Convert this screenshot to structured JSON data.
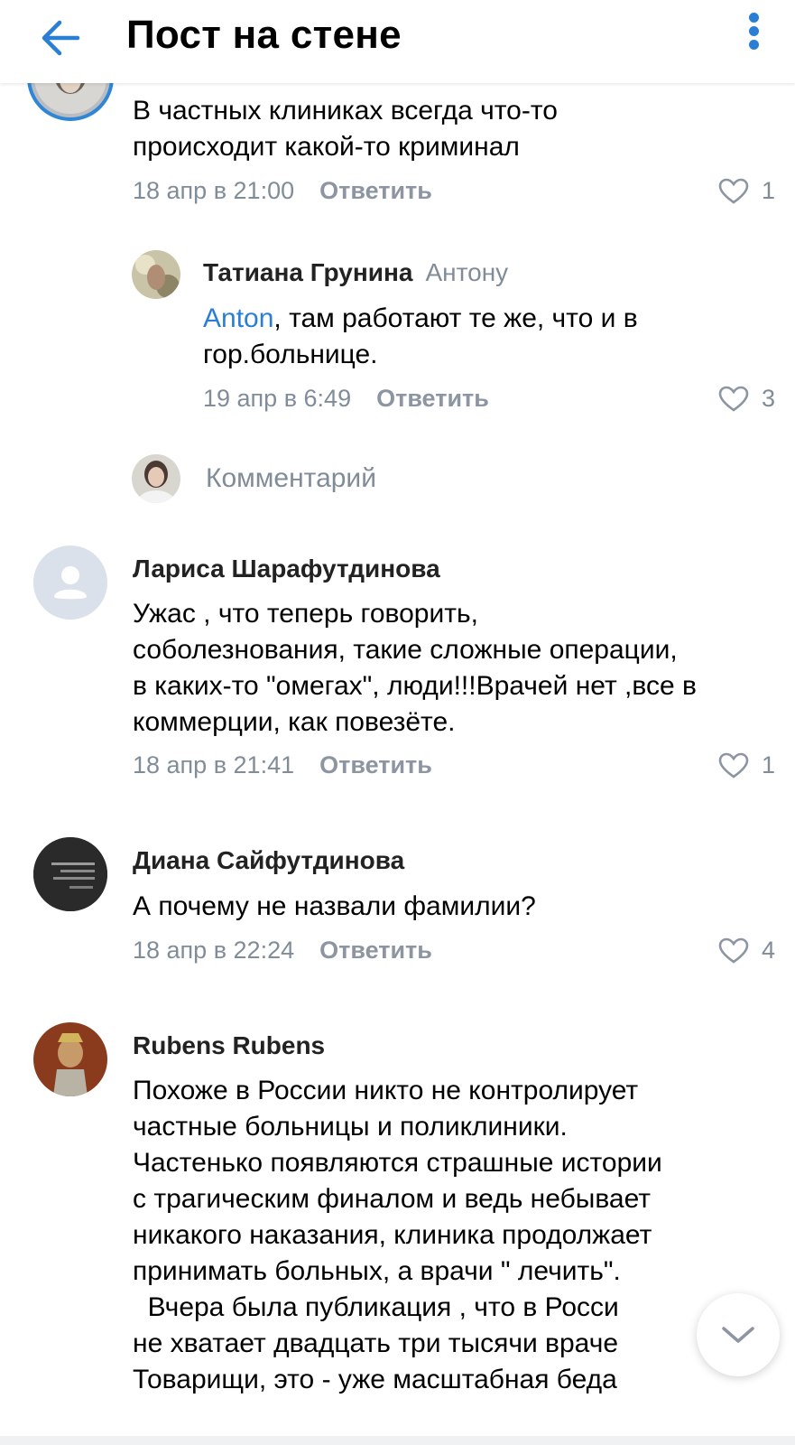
{
  "header": {
    "title": "Пост на стене"
  },
  "comments": [
    {
      "text_lines": [
        "В частных клиниках всегда  что-то",
        "происходит какой-то криминал"
      ],
      "date": "18 апр в 21:00",
      "reply_label": "Ответить",
      "likes": "1"
    },
    {
      "author": "Татиана Грунина",
      "reply_to": "Антону",
      "mention": "Anton",
      "text_rest": ", там работают те же, что и в",
      "text_line2": "гор.больнице.",
      "date": "19 апр в 6:49",
      "reply_label": "Ответить",
      "likes": "3"
    },
    {
      "author": "Лариса Шарафутдинова",
      "text_lines": [
        "Ужас , что теперь говорить,",
        "соболезнования, такие сложные операции,",
        "в каких-то \"омегах\", люди!!!Врачей нет ,все в",
        "коммерции, как повезёте."
      ],
      "date": "18 апр в 21:41",
      "reply_label": "Ответить",
      "likes": "1"
    },
    {
      "author": "Диана Сайфутдинова",
      "text_lines": [
        "А почему не назвали фамилии?"
      ],
      "date": "18 апр в 22:24",
      "reply_label": "Ответить",
      "likes": "4"
    },
    {
      "author": "Rubens Rubens",
      "text_lines": [
        "Похоже в России никто не контролирует",
        "частные больницы и поликлиники.",
        "Частенько появляются страшные истории",
        "с трагическим финалом и ведь небывает",
        "никакого наказания, клиника продолжает",
        "принимать больных, а врачи \" лечить\".",
        "  Вчера была публикация , что в Росси",
        "не хватает двадцать три тысячи враче",
        "Товарищи, это - уже масштабная беда"
      ]
    }
  ],
  "reply_input": {
    "placeholder": "Комментарий"
  },
  "colors": {
    "accent": "#2a7fd4",
    "secondary_text": "#818c99"
  }
}
